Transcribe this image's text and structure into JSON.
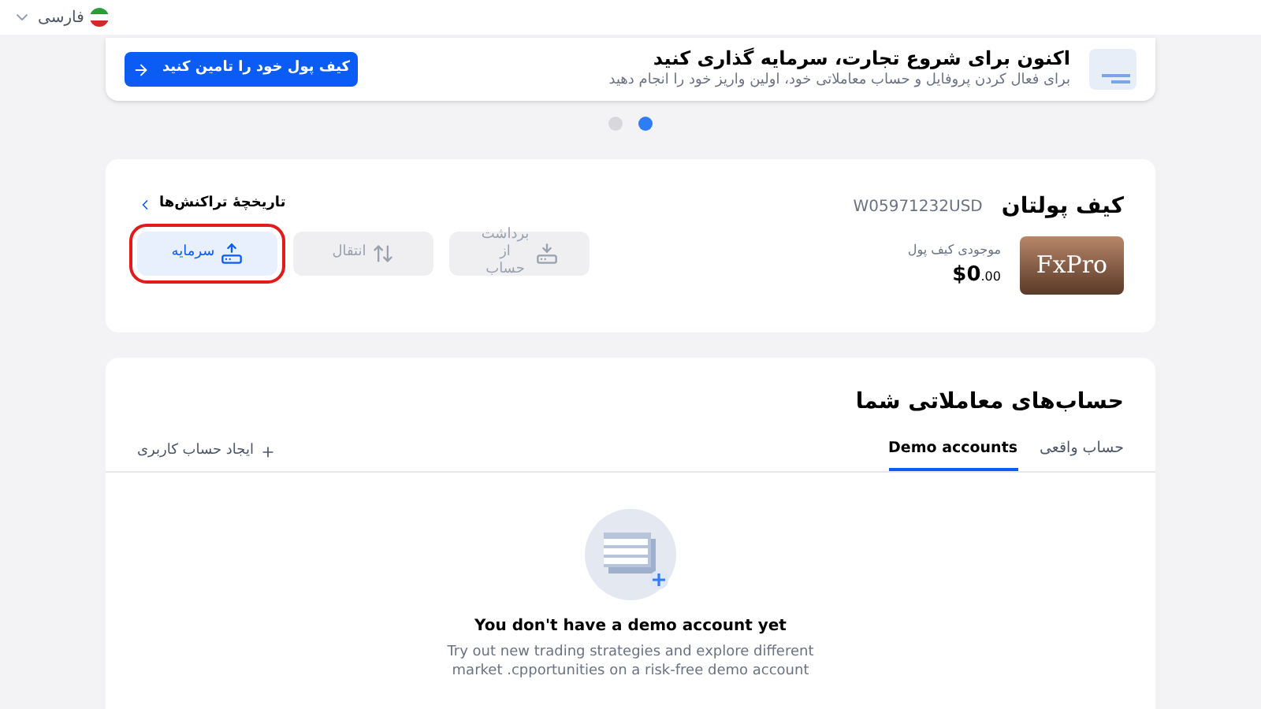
{
  "header": {
    "language": "فارسی"
  },
  "banner": {
    "title": "اکنون برای شروع تجارت، سرمایه گذاری کنید",
    "subtitle": "برای فعال کردن پروفایل و حساب معاملاتی خود، اولین واریز خود را انجام دهید",
    "button": "کیف پول خود را تامین کنید"
  },
  "carousel_dots": [
    {
      "selected": false
    },
    {
      "selected": true
    }
  ],
  "wallet": {
    "title": "کیف پولتان",
    "account_id": "W05971232USD",
    "logo": "FxPro",
    "balance_label": "موجودی کیف پول",
    "balance": "$0",
    "balance_cents": ".00",
    "history_link": "تاریخچهٔ تراکنش‌ها",
    "actions": [
      {
        "kind": "withdraw",
        "label": "برداشت از حساب",
        "disabled": true,
        "highlighted": false
      },
      {
        "kind": "transfer",
        "label": "انتقال",
        "disabled": true,
        "highlighted": false
      },
      {
        "kind": "deposit",
        "label": "سرمایه",
        "disabled": false,
        "highlighted": true
      }
    ]
  },
  "accounts": {
    "title": "حساب‌های معاملاتی شما",
    "tabs": [
      {
        "label": "حساب واقعی",
        "selected": false
      },
      {
        "label": "Demo accounts",
        "selected": true
      }
    ],
    "create_link": "ایجاد حساب کاربری",
    "empty_title": "You don't have a demo account yet",
    "empty_text": "Try out new trading strategies and explore different market .cpportunities on a risk-free demo account"
  }
}
